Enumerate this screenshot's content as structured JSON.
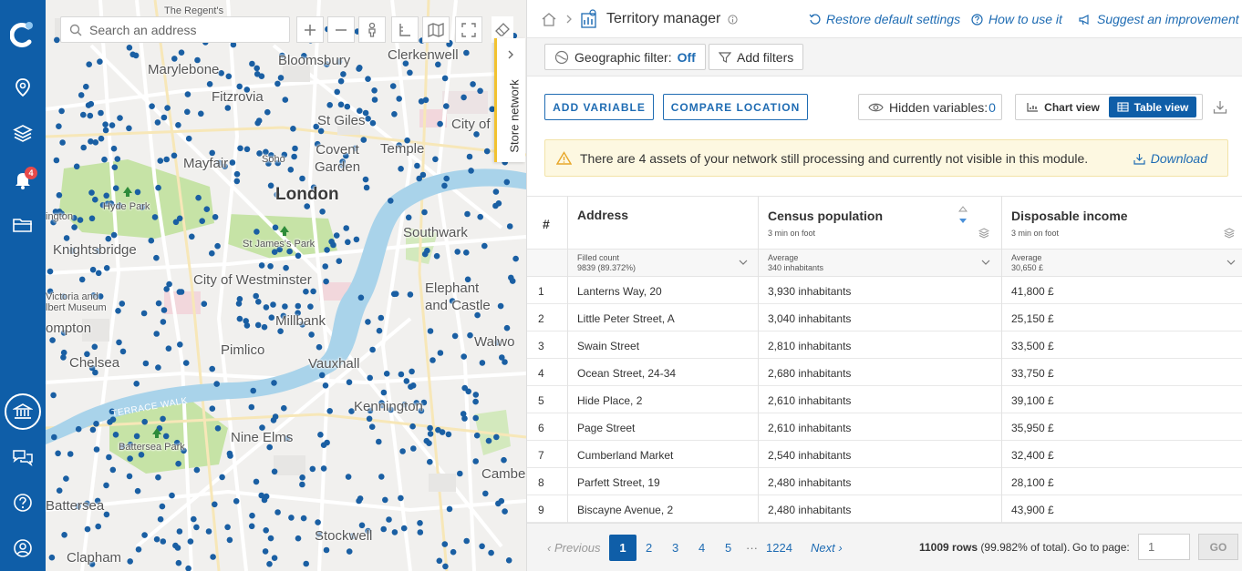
{
  "nav": {
    "notification_count": "4",
    "items": [
      "logo-icon",
      "location-pin-icon",
      "layers-icon",
      "bell-icon",
      "folder-icon",
      "bank-icon",
      "chat-icon",
      "help-icon",
      "user-icon"
    ]
  },
  "map": {
    "search_placeholder": "Search an address",
    "store_network_tab": "Store network",
    "labels": {
      "regents": "The Regent's",
      "bloomsbury": "Bloomsbury",
      "clerkenwell": "Clerkenwell",
      "marylebone": "Marylebone",
      "fitzrovia": "Fitzrovia",
      "st_giles": "St Giles",
      "city_of": "City of",
      "covent_garden": "Covent\nGarden",
      "temple": "Temple",
      "soho": "Soho",
      "mayfair": "Mayfair",
      "london": "London",
      "hyde_park": "Hyde Park",
      "southwark": "Southwark",
      "st_james": "St James's Park",
      "knightsbridge": "Knightsbridge",
      "city_westminster": "City of Westminster",
      "victoria_albert": "Victoria and\nlbert Museum",
      "millbank": "Millbank",
      "elephant": "Elephant\nand Castle",
      "pimlico": "Pimlico",
      "chelsea": "Chelsea",
      "vauxhall": "Vauxhall",
      "walworth": "Walwo",
      "terrace_walk": "TERRACE WALK",
      "kennington": "Kennington",
      "battersea_park": "Battersea Park",
      "nine_elms": "Nine Elms",
      "camberwell": "Cambe",
      "battersea": "Battersea",
      "stockwell": "Stockwell",
      "clapham": "Clapham",
      "brompton": "ompton",
      "ington": "ington"
    }
  },
  "topbar": {
    "title": "Territory manager",
    "restore": "Restore default settings",
    "how_to": "How to use it",
    "suggest": "Suggest an improvement"
  },
  "filters": {
    "geo_label": "Geographic filter:",
    "geo_value": "Off",
    "add_filters": "Add filters"
  },
  "actions": {
    "add_variable": "ADD VARIABLE",
    "compare_location": "COMPARE LOCATION",
    "hidden_label": "Hidden variables:",
    "hidden_count": "0",
    "chart_view": "Chart view",
    "table_view": "Table view"
  },
  "warning": {
    "text": "There are 4 assets of your network still processing and currently not visible in this module.",
    "download": "Download"
  },
  "table": {
    "columns": [
      {
        "title": "#",
        "sub": "",
        "stat_label": "",
        "stat_value": ""
      },
      {
        "title": "Address",
        "sub": "",
        "stat_label": "Filled count",
        "stat_value": "9839 (89.372%)"
      },
      {
        "title": "Census population",
        "sub": "3 min on foot",
        "stat_label": "Average",
        "stat_value": "340 inhabitants"
      },
      {
        "title": "Disposable income",
        "sub": "3 min on foot",
        "stat_label": "Average",
        "stat_value": "30,650 £"
      }
    ],
    "rows": [
      {
        "n": "1",
        "address": "Lanterns Way, 20",
        "population": "3,930 inhabitants",
        "income": "41,800 £"
      },
      {
        "n": "2",
        "address": "Little Peter Street, A",
        "population": "3,040 inhabitants",
        "income": "25,150 £"
      },
      {
        "n": "3",
        "address": "Swain Street",
        "population": "2,810 inhabitants",
        "income": "33,500 £"
      },
      {
        "n": "4",
        "address": "Ocean Street, 24-34",
        "population": "2,680 inhabitants",
        "income": "33,750 £"
      },
      {
        "n": "5",
        "address": "Hide Place, 2",
        "population": "2,610 inhabitants",
        "income": "39,100 £"
      },
      {
        "n": "6",
        "address": "Page Street",
        "population": "2,610 inhabitants",
        "income": "35,950 £"
      },
      {
        "n": "7",
        "address": "Cumberland Market",
        "population": "2,540 inhabitants",
        "income": "32,400 £"
      },
      {
        "n": "8",
        "address": "Parfett Street, 19",
        "population": "2,480 inhabitants",
        "income": "28,100 £"
      },
      {
        "n": "9",
        "address": "Biscayne Avenue, 2",
        "population": "2,480 inhabitants",
        "income": "43,900 £"
      }
    ]
  },
  "pager": {
    "previous": "Previous",
    "pages": [
      "1",
      "2",
      "3",
      "4",
      "5",
      "···",
      "1224"
    ],
    "next": "Next",
    "rows_bold": "11009 rows",
    "rows_rest": " (99.982% of total).",
    "goto_label": "Go to page:",
    "goto_placeholder": "1",
    "go": "GO"
  },
  "colors": {
    "nav_blue": "#0f5ea8",
    "link_blue": "#1f6cb3",
    "dot_blue": "#1a5fa3",
    "river": "#a9d3ea",
    "park": "#c6e3a6",
    "warning_bg": "#fdf8e1",
    "badge_red": "#e84a4a",
    "store_tab_accent": "#f2c230"
  }
}
